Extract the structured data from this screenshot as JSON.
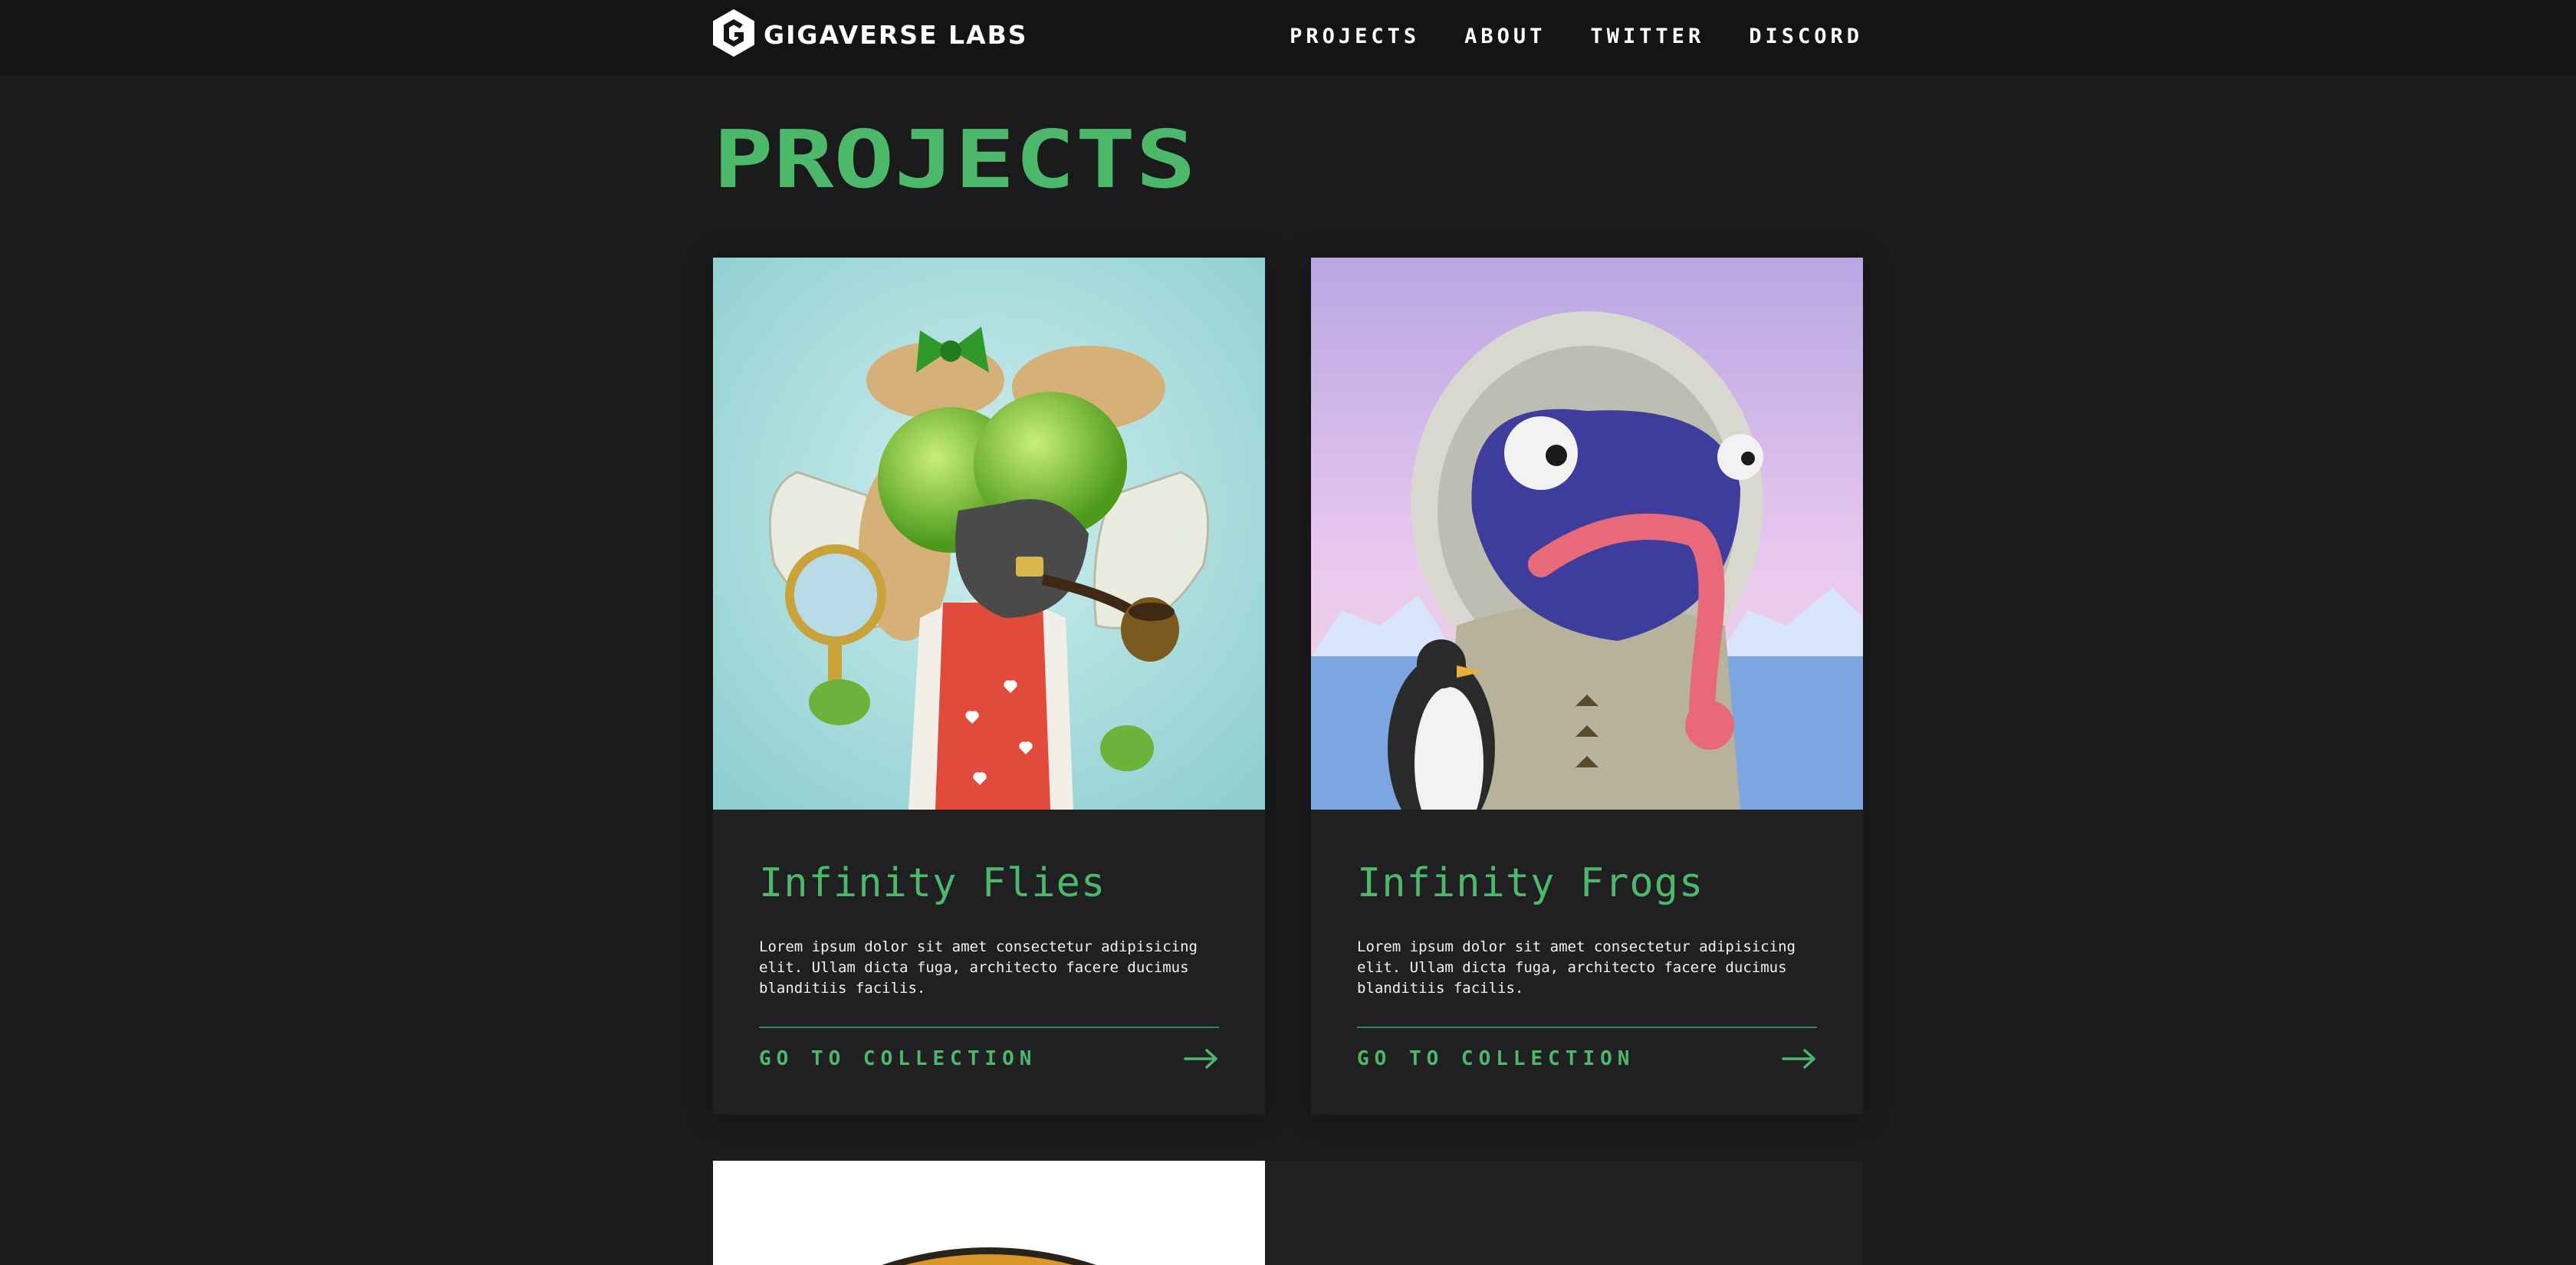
{
  "header": {
    "brand_name": "GIGAVERSE LABS",
    "logo_icon": "hexagon-g-logo-icon",
    "nav": [
      {
        "label": "PROJECTS"
      },
      {
        "label": "ABOUT"
      },
      {
        "label": "TWITTER"
      },
      {
        "label": "DISCORD"
      }
    ]
  },
  "main": {
    "title": "PROJECTS",
    "projects": [
      {
        "name": "Infinity Flies",
        "description": "Lorem ipsum dolor sit amet consectetur adipisicing elit. Ullam dicta fuga, architecto facere ducimus blanditiis facilis.",
        "link_label": "GO TO COLLECTION",
        "image": "fly-character-art"
      },
      {
        "name": "Infinity Frogs",
        "description": "Lorem ipsum dolor sit amet consectetur adipisicing elit. Ullam dicta fuga, architecto facere ducimus blanditiis facilis.",
        "link_label": "GO TO COLLECTION",
        "image": "frog-character-art"
      }
    ]
  },
  "colors": {
    "background": "#1b1b1d",
    "header_background": "#141415",
    "card_background": "#202023",
    "accent_green": "#4cb96a"
  }
}
